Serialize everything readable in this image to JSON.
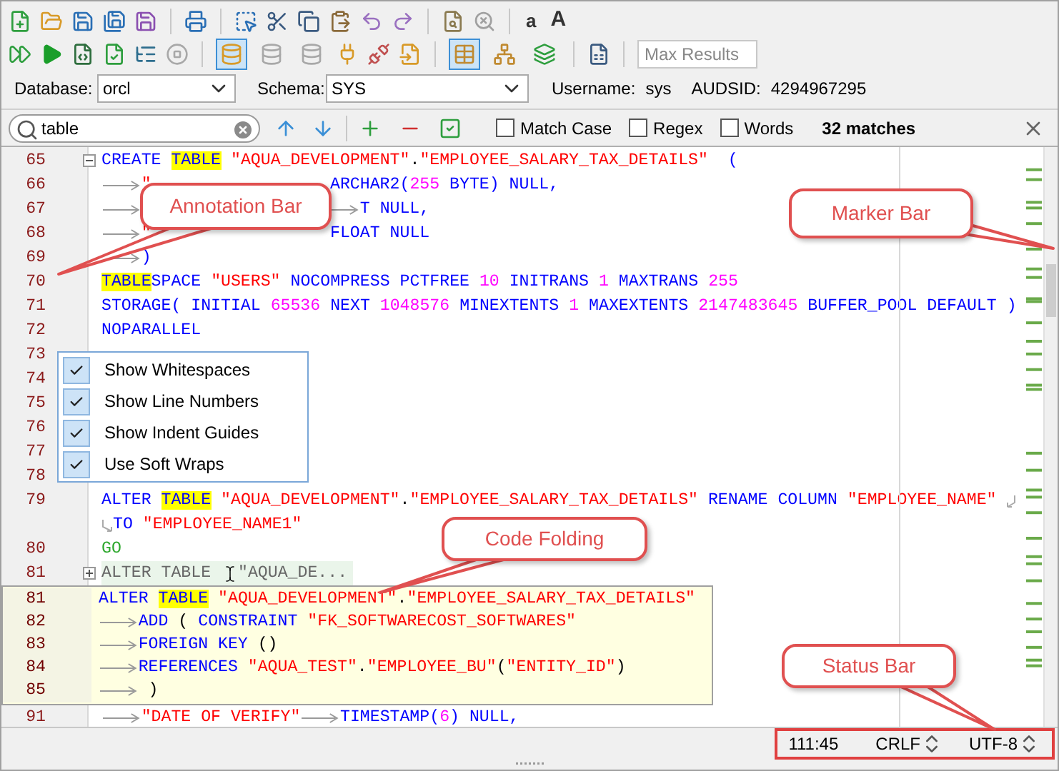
{
  "toolbar": {
    "font_buttons": [
      "a",
      "A"
    ],
    "toggles": [
      {
        "selected": true
      },
      {
        "selected": false
      },
      {
        "selected": false
      },
      {
        "selected": true
      },
      {
        "selected": false
      },
      {
        "selected": false
      }
    ],
    "max_results": {
      "placeholder": "Max Results"
    }
  },
  "connection": {
    "database": {
      "label": "Database:",
      "value": "orcl"
    },
    "schema": {
      "label": "Schema:",
      "value": "SYS"
    },
    "username": {
      "label": "Username:",
      "value": "sys"
    },
    "audsid": {
      "label": "AUDSID:",
      "value": "4294967295"
    }
  },
  "search": {
    "value": "table",
    "options": [
      {
        "label": "Match Case",
        "checked": false
      },
      {
        "label": "Regex",
        "checked": false
      },
      {
        "label": "Words",
        "checked": false
      }
    ],
    "matches": "32 matches"
  },
  "editor": {
    "lines": [
      {
        "number": "65",
        "folded": false,
        "tokens": [
          {
            "kind": "kw",
            "text": "CREATE"
          },
          {
            "kind": "sp"
          },
          {
            "kind": "hit",
            "text": "TABLE"
          },
          {
            "kind": "sp"
          },
          {
            "kind": "str",
            "text": "\"AQUA_DEVELOPMENT\""
          },
          {
            "kind": "plain",
            "text": "."
          },
          {
            "kind": "str",
            "text": "\"EMPLOYEE_SALARY_TAX_DETAILS\""
          },
          {
            "kind": "sp"
          },
          {
            "kind": "sp"
          },
          {
            "kind": "kw",
            "text": "("
          }
        ]
      },
      {
        "number": "66",
        "tokens": [
          {
            "kind": "tab"
          },
          {
            "kind": "str",
            "text": "\""
          },
          {
            "kind": "covered"
          },
          {
            "kind": "kw",
            "text": "ARCHAR2("
          },
          {
            "kind": "num",
            "text": "255"
          },
          {
            "kind": "sp"
          },
          {
            "kind": "kw",
            "text": "BYTE)"
          },
          {
            "kind": "sp"
          },
          {
            "kind": "kw",
            "text": "NULL,"
          }
        ]
      },
      {
        "number": "67",
        "tokens": [
          {
            "kind": "tab"
          },
          {
            "kind": "covered"
          },
          {
            "kind": "tab"
          },
          {
            "kind": "kw",
            "text": "T"
          },
          {
            "kind": "sp"
          },
          {
            "kind": "kw",
            "text": "NULL,"
          }
        ]
      },
      {
        "number": "68",
        "tokens": [
          {
            "kind": "tab"
          },
          {
            "kind": "str",
            "text": "\""
          },
          {
            "kind": "covered"
          },
          {
            "kind": "kw",
            "text": "FLOAT"
          },
          {
            "kind": "sp"
          },
          {
            "kind": "kw",
            "text": "NULL"
          }
        ]
      },
      {
        "number": "69",
        "tokens": [
          {
            "kind": "tab"
          },
          {
            "kind": "kw",
            "text": ")"
          }
        ]
      },
      {
        "number": "70",
        "tokens": [
          {
            "kind": "hit",
            "text": "TABLE"
          },
          {
            "kind": "kw",
            "text": "SPACE"
          },
          {
            "kind": "sp"
          },
          {
            "kind": "str",
            "text": "\"USERS\""
          },
          {
            "kind": "sp"
          },
          {
            "kind": "kw",
            "text": "NOCOMPRESS"
          },
          {
            "kind": "sp"
          },
          {
            "kind": "kw",
            "text": "PCTFREE"
          },
          {
            "kind": "sp"
          },
          {
            "kind": "num",
            "text": "10"
          },
          {
            "kind": "sp"
          },
          {
            "kind": "kw",
            "text": "INITRANS"
          },
          {
            "kind": "sp"
          },
          {
            "kind": "num",
            "text": "1"
          },
          {
            "kind": "sp"
          },
          {
            "kind": "kw",
            "text": "MAXTRANS"
          },
          {
            "kind": "sp"
          },
          {
            "kind": "num",
            "text": "255"
          }
        ]
      },
      {
        "number": "71",
        "tokens": [
          {
            "kind": "kw",
            "text": "STORAGE("
          },
          {
            "kind": "sp"
          },
          {
            "kind": "kw",
            "text": "INITIAL"
          },
          {
            "kind": "sp"
          },
          {
            "kind": "num",
            "text": "65536"
          },
          {
            "kind": "sp"
          },
          {
            "kind": "kw",
            "text": "NEXT"
          },
          {
            "kind": "sp"
          },
          {
            "kind": "num",
            "text": "1048576"
          },
          {
            "kind": "sp"
          },
          {
            "kind": "kw",
            "text": "MINEXTENTS"
          },
          {
            "kind": "sp"
          },
          {
            "kind": "num",
            "text": "1"
          },
          {
            "kind": "sp"
          },
          {
            "kind": "kw",
            "text": "MAXEXTENTS"
          },
          {
            "kind": "sp"
          },
          {
            "kind": "num",
            "text": "2147483645"
          },
          {
            "kind": "sp"
          },
          {
            "kind": "kw",
            "text": "BUFFER_POOL"
          },
          {
            "kind": "sp"
          },
          {
            "kind": "kw",
            "text": "DEFAULT"
          },
          {
            "kind": "sp"
          },
          {
            "kind": "kw",
            "text": ")"
          }
        ]
      },
      {
        "number": "72",
        "tokens": [
          {
            "kind": "kw",
            "text": "NOPARALLEL"
          }
        ]
      },
      {
        "number": "73"
      },
      {
        "number": "74"
      },
      {
        "number": "75"
      },
      {
        "number": "76"
      },
      {
        "number": "77"
      },
      {
        "number": "78"
      },
      {
        "number": "79",
        "tokens": [
          {
            "kind": "kw",
            "text": "ALTER"
          },
          {
            "kind": "sp"
          },
          {
            "kind": "hit",
            "text": "TABLE"
          },
          {
            "kind": "sp"
          },
          {
            "kind": "str",
            "text": "\"AQUA_DEVELOPMENT\""
          },
          {
            "kind": "plain",
            "text": "."
          },
          {
            "kind": "str",
            "text": "\"EMPLOYEE_SALARY_TAX_DETAILS\""
          },
          {
            "kind": "sp"
          },
          {
            "kind": "kw",
            "text": "RENAME"
          },
          {
            "kind": "sp"
          },
          {
            "kind": "kw",
            "text": "COLUMN"
          },
          {
            "kind": "sp"
          },
          {
            "kind": "str",
            "text": "\"EMPLOYEE_NAME\""
          },
          {
            "kind": "sp"
          },
          {
            "kind": "wrap"
          }
        ]
      },
      {
        "tokens": [
          {
            "kind": "wrapin"
          },
          {
            "kind": "kw",
            "text": "TO"
          },
          {
            "kind": "sp"
          },
          {
            "kind": "str",
            "text": "\"EMPLOYEE_NAME1\""
          }
        ]
      },
      {
        "number": "80",
        "tokens": [
          {
            "kind": "go",
            "text": "GO"
          }
        ]
      },
      {
        "number": "81",
        "folded": true,
        "tokens": [
          {
            "kind": "dim",
            "text": "ALTER TABLE"
          },
          {
            "kind": "sp"
          },
          {
            "kind": "caret"
          },
          {
            "kind": "dim",
            "text": "\"AQUA_DE..."
          }
        ]
      }
    ],
    "wrap_menu": {
      "items": [
        {
          "label": "Show Whitespaces",
          "checked": true
        },
        {
          "label": "Show Line Numbers",
          "checked": true
        },
        {
          "label": "Show Indent Guides",
          "checked": true
        },
        {
          "label": "Use Soft Wraps",
          "checked": true
        }
      ]
    },
    "fold_preview": {
      "lines": [
        {
          "number": "81",
          "tokens": [
            {
              "kind": "kw",
              "text": "ALTER"
            },
            {
              "kind": "sp"
            },
            {
              "kind": "hit",
              "text": "TABLE"
            },
            {
              "kind": "sp"
            },
            {
              "kind": "str",
              "text": "\"AQUA_DEVELOPMENT\""
            },
            {
              "kind": "plain",
              "text": "."
            },
            {
              "kind": "str",
              "text": "\"EMPLOYEE_SALARY_TAX_DETAILS\""
            }
          ]
        },
        {
          "number": "82",
          "tokens": [
            {
              "kind": "tab"
            },
            {
              "kind": "kw",
              "text": "ADD"
            },
            {
              "kind": "sp"
            },
            {
              "kind": "plain",
              "text": "("
            },
            {
              "kind": "sp"
            },
            {
              "kind": "kw",
              "text": "CONSTRAINT"
            },
            {
              "kind": "sp"
            },
            {
              "kind": "str",
              "text": "\"FK_SOFTWARECOST_SOFTWARES\""
            }
          ]
        },
        {
          "number": "83",
          "tokens": [
            {
              "kind": "tab"
            },
            {
              "kind": "kw",
              "text": "FOREIGN"
            },
            {
              "kind": "sp"
            },
            {
              "kind": "kw",
              "text": "KEY"
            },
            {
              "kind": "sp"
            },
            {
              "kind": "plain",
              "text": "()"
            }
          ]
        },
        {
          "number": "84",
          "tokens": [
            {
              "kind": "tab"
            },
            {
              "kind": "kw",
              "text": "REFERENCES"
            },
            {
              "kind": "sp"
            },
            {
              "kind": "str",
              "text": "\"AQUA_TEST\""
            },
            {
              "kind": "plain",
              "text": "."
            },
            {
              "kind": "str",
              "text": "\"EMPLOYEE_BU\""
            },
            {
              "kind": "plain",
              "text": "("
            },
            {
              "kind": "str",
              "text": "\"ENTITY_ID\""
            },
            {
              "kind": "plain",
              "text": ")"
            }
          ]
        },
        {
          "number": "85",
          "tokens": [
            {
              "kind": "tab"
            },
            {
              "kind": "sp"
            },
            {
              "kind": "plain",
              "text": ")"
            }
          ]
        }
      ]
    },
    "after_lines": [
      {
        "number": "91",
        "tokens": [
          {
            "kind": "tab"
          },
          {
            "kind": "str",
            "text": "\"DATE OF VERIFY\""
          },
          {
            "kind": "tab"
          },
          {
            "kind": "kw",
            "text": "TIMESTAMP("
          },
          {
            "kind": "num",
            "text": "6"
          },
          {
            "kind": "kw",
            "text": ")"
          },
          {
            "kind": "sp"
          },
          {
            "kind": "kw",
            "text": "NULL,"
          }
        ]
      }
    ]
  },
  "callouts": [
    {
      "kind": "annotation",
      "text": "Annotation Bar"
    },
    {
      "kind": "marker",
      "text": "Marker Bar"
    },
    {
      "kind": "folding",
      "text": "Code Folding"
    },
    {
      "kind": "status",
      "text": "Status Bar"
    }
  ],
  "status_bar": {
    "position": "111:45",
    "line_ending": "CRLF",
    "encoding": "UTF-8"
  }
}
